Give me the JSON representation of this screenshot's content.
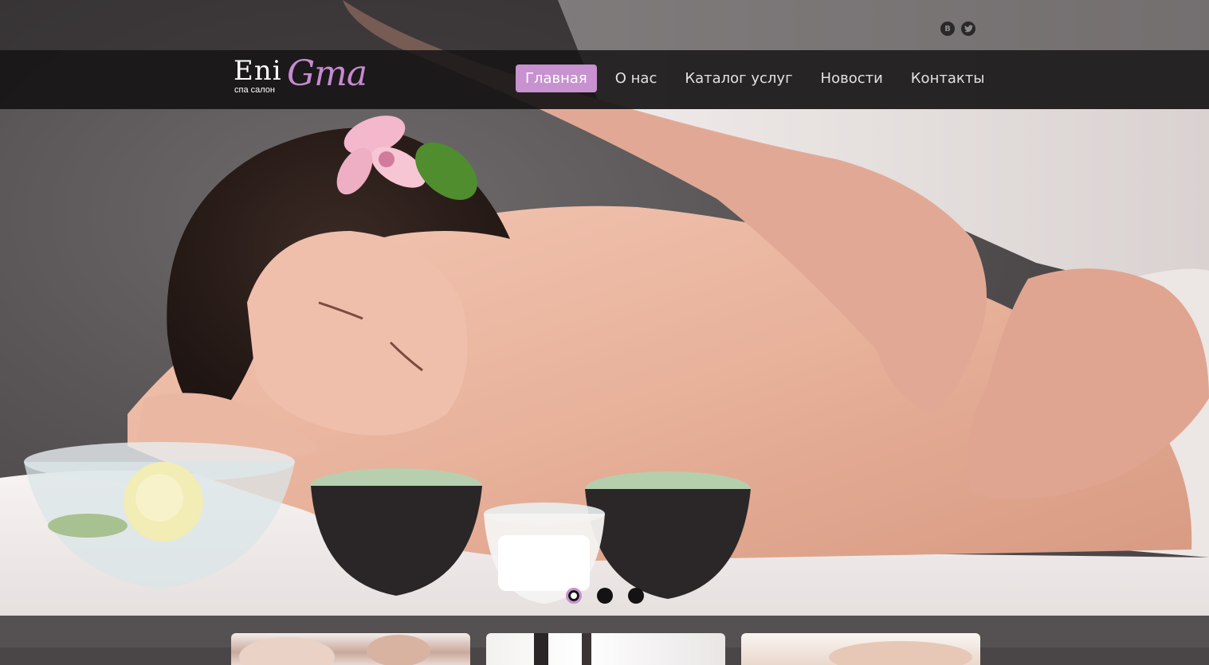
{
  "brand": {
    "logo_part1": "Eni",
    "logo_part2": "Gma",
    "tagline": "спа салон"
  },
  "social": [
    {
      "label": "B",
      "icon": "vk-icon"
    },
    {
      "label": "🐦",
      "icon": "twitter-icon"
    }
  ],
  "nav": {
    "items": [
      {
        "label": "Главная",
        "active": true
      },
      {
        "label": "О нас",
        "active": false
      },
      {
        "label": "Каталог услуг",
        "active": false
      },
      {
        "label": "Новости",
        "active": false
      },
      {
        "label": "Контакты",
        "active": false
      }
    ]
  },
  "slider": {
    "slide_count": 3,
    "active_slide": 1
  },
  "colors": {
    "accent": "#c792cf",
    "nav_bg": "#161415",
    "lower_bg": "#555152"
  }
}
